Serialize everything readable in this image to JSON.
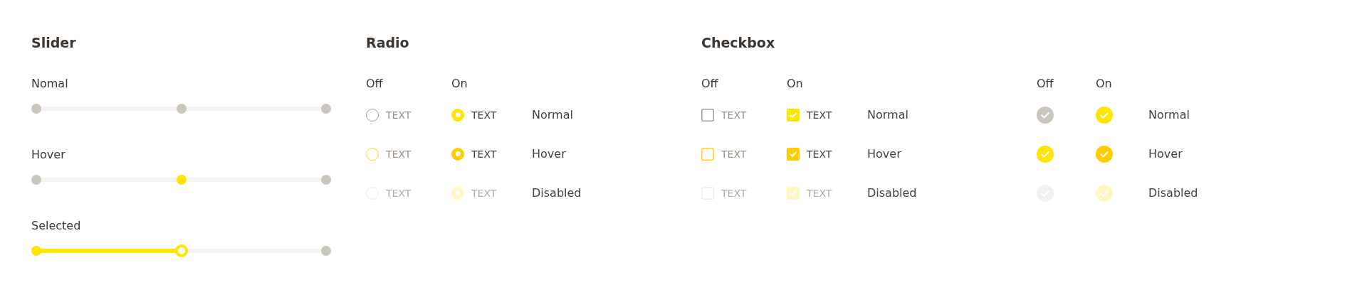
{
  "slider": {
    "title": "Slider",
    "items": [
      {
        "label": "Nomal",
        "kind": "normal",
        "level": 0.5
      },
      {
        "label": "Hover",
        "kind": "hover",
        "level": 0.5
      },
      {
        "label": "Selected",
        "kind": "selected",
        "level": 0.5
      }
    ]
  },
  "radio": {
    "title": "Radio",
    "columns": [
      "Off",
      "On"
    ],
    "rows": [
      {
        "kind": "normal",
        "label": "Normal",
        "items": [
          {
            "text": "TEXT",
            "checked": false
          },
          {
            "text": "TEXT",
            "checked": true
          }
        ]
      },
      {
        "kind": "hover",
        "label": "Hover",
        "items": [
          {
            "text": "TEXT",
            "checked": false
          },
          {
            "text": "TEXT",
            "checked": true
          }
        ]
      },
      {
        "kind": "disabled",
        "label": "Disabled",
        "items": [
          {
            "text": "TEXT",
            "checked": false
          },
          {
            "text": "TEXT",
            "checked": true
          }
        ]
      }
    ]
  },
  "checkbox": {
    "title": "Checkbox",
    "columns": [
      "Off",
      "On"
    ],
    "rows": [
      {
        "kind": "normal",
        "label": "Normal",
        "items": [
          {
            "text": "TEXT",
            "checked": false
          },
          {
            "text": "TEXT",
            "checked": true
          }
        ]
      },
      {
        "kind": "hover",
        "label": "Hover",
        "items": [
          {
            "text": "TEXT",
            "checked": false
          },
          {
            "text": "TEXT",
            "checked": true
          }
        ]
      },
      {
        "kind": "disabled",
        "label": "Disabled",
        "items": [
          {
            "text": "TEXT",
            "checked": false
          },
          {
            "text": "TEXT",
            "checked": true
          }
        ]
      }
    ]
  },
  "check_circle": {
    "columns": [
      "Off",
      "On"
    ],
    "rows": [
      {
        "kind": "normal",
        "label": "Normal",
        "items": [
          {
            "checked": false
          },
          {
            "checked": true
          }
        ]
      },
      {
        "kind": "hover",
        "label": "Hover",
        "items": [
          {
            "checked": false
          },
          {
            "checked": true
          }
        ]
      },
      {
        "kind": "disabled",
        "label": "Disabled",
        "items": [
          {
            "checked": false
          },
          {
            "checked": true
          }
        ]
      }
    ]
  }
}
